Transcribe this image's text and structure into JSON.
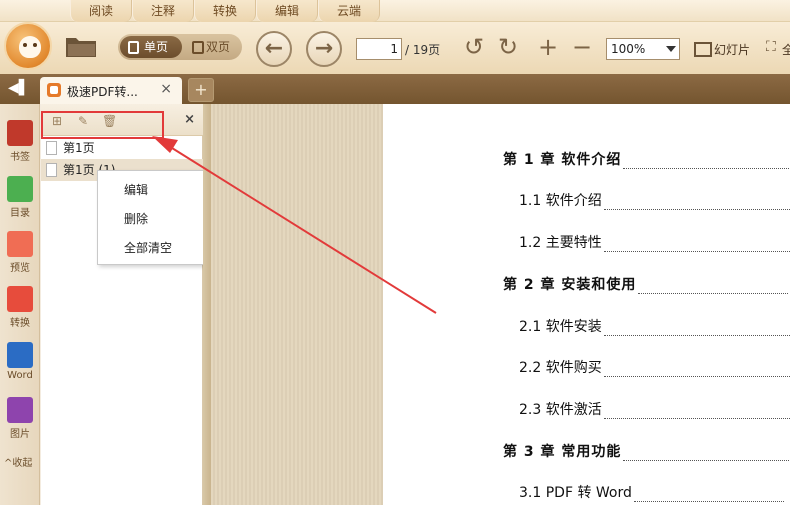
{
  "menu_tabs": [
    "阅读",
    "注释",
    "转换",
    "编辑",
    "云端"
  ],
  "toolbar": {
    "single_page": "单页",
    "double_page": "双页",
    "page_current": "1",
    "page_total": "/ 19页",
    "zoom": "100%",
    "slideshow": "幻灯片",
    "fullscreen": "全"
  },
  "doc_tab": {
    "title": "极速PDF转...",
    "close": "×",
    "new_tab": "+"
  },
  "rail": [
    {
      "label": "书签",
      "icon": "bookmark-icon",
      "color": "#c0392b"
    },
    {
      "label": "目录",
      "icon": "toc-icon",
      "color": "#4caf50"
    },
    {
      "label": "预览",
      "icon": "preview-icon",
      "color": "#f06d54"
    },
    {
      "label": "转换",
      "icon": "convert-icon",
      "color": "#e74c3c"
    },
    {
      "label": "Word",
      "icon": "word-icon",
      "color": "#2b6cc4"
    },
    {
      "label": "图片",
      "icon": "image-icon",
      "color": "#8e44ad"
    }
  ],
  "rail_collapse": "^收起",
  "bookmark_panel": {
    "items": [
      "第1页",
      "第1页 (1)"
    ],
    "close": "×"
  },
  "context_menu": [
    "编辑",
    "删除",
    "全部清空"
  ],
  "toc": [
    {
      "text": "第 1 章  软件介绍",
      "chapter": true
    },
    {
      "text": "1.1 软件介绍",
      "chapter": false
    },
    {
      "text": "1.2 主要特性",
      "chapter": false
    },
    {
      "text": "第 2 章   安装和使用",
      "chapter": true
    },
    {
      "text": "2.1 软件安装",
      "chapter": false
    },
    {
      "text": "2.2 软件购买",
      "chapter": false
    },
    {
      "text": "2.3 软件激活",
      "chapter": false
    },
    {
      "text": "第 3 章  常用功能",
      "chapter": true
    },
    {
      "text": "3.1  PDF 转 Word",
      "chapter": false
    }
  ],
  "colors": {
    "accent": "#e57a2a",
    "annotation_red": "#e23a3a",
    "docbar": "#7a5a35"
  }
}
